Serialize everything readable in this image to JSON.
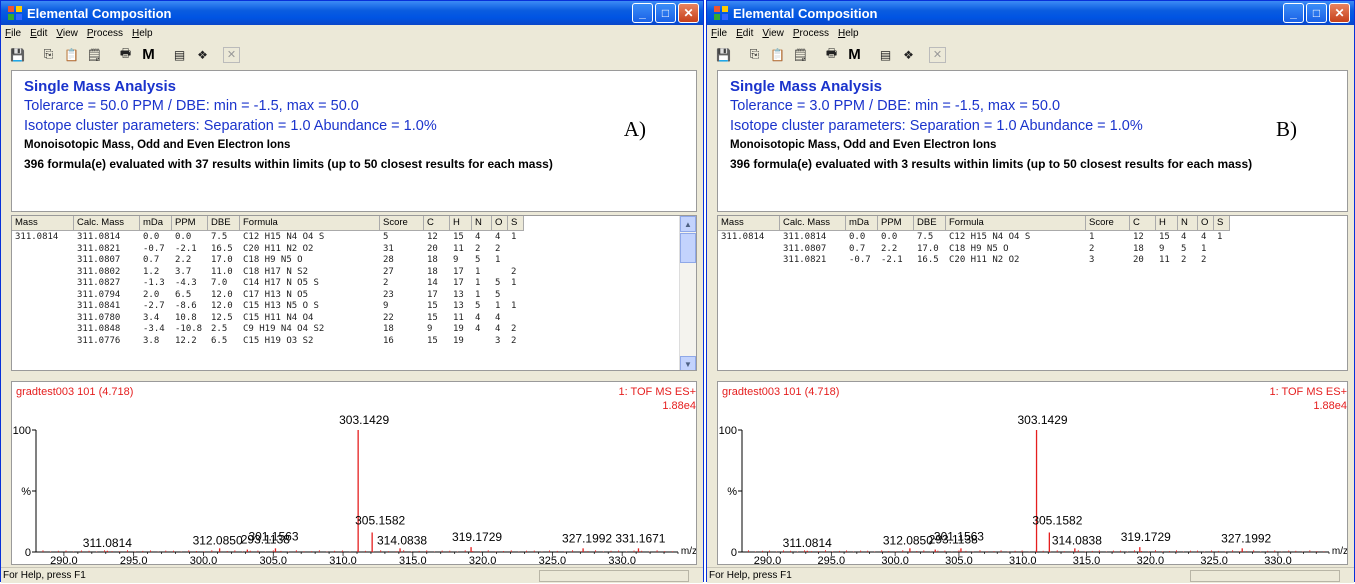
{
  "colors": {
    "title_blue": "#0054e3",
    "info_blue": "#1a33cc",
    "spectrum_red": "#e51e1e"
  },
  "windowA": {
    "title": "Elemental Composition",
    "panel_label": "A)",
    "menu": [
      "File",
      "Edit",
      "View",
      "Process",
      "Help"
    ],
    "info": {
      "heading": "Single Mass Analysis",
      "tolerance": "Tolerarce = 50.0 PPM   /  DBE: min = -1.5, max = 50.0",
      "isotope": "Isotope cluster parameters: Separation = 1.0   Abundance = 1.0%",
      "ion_mode": "Monoisotopic Mass, Odd and Even Electron Ions",
      "summary": "396 formula(e) evaluated with 37 results within limits (up to 50 closest results for each mass)"
    },
    "columns": [
      "Mass",
      "Calc. Mass",
      "mDa",
      "PPM",
      "DBE",
      "Formula",
      "Score",
      "C",
      "H",
      "N",
      "O",
      "S"
    ],
    "rows": [
      [
        "311.0814",
        "311.0814",
        "0.0",
        "0.0",
        "7.5",
        "C12 H15 N4 O4 S",
        "5",
        "12",
        "15",
        "4",
        "4",
        "1"
      ],
      [
        "",
        "311.0821",
        "-0.7",
        "-2.1",
        "16.5",
        "C20 H11 N2 O2",
        "31",
        "20",
        "11",
        "2",
        "2",
        ""
      ],
      [
        "",
        "311.0807",
        "0.7",
        "2.2",
        "17.0",
        "C18 H9 N5 O",
        "28",
        "18",
        "9",
        "5",
        "1",
        ""
      ],
      [
        "",
        "311.0802",
        "1.2",
        "3.7",
        "11.0",
        "C18 H17 N S2",
        "27",
        "18",
        "17",
        "1",
        "",
        "2"
      ],
      [
        "",
        "311.0827",
        "-1.3",
        "-4.3",
        "7.0",
        "C14 H17 N O5 S",
        "2",
        "14",
        "17",
        "1",
        "5",
        "1"
      ],
      [
        "",
        "311.0794",
        "2.0",
        "6.5",
        "12.0",
        "C17 H13 N O5",
        "23",
        "17",
        "13",
        "1",
        "5",
        ""
      ],
      [
        "",
        "311.0841",
        "-2.7",
        "-8.6",
        "12.0",
        "C15 H13 N5 O S",
        "9",
        "15",
        "13",
        "5",
        "1",
        "1"
      ],
      [
        "",
        "311.0780",
        "3.4",
        "10.8",
        "12.5",
        "C15 H11 N4 O4",
        "22",
        "15",
        "11",
        "4",
        "4",
        ""
      ],
      [
        "",
        "311.0848",
        "-3.4",
        "-10.8",
        "2.5",
        "C9 H19 N4 O4 S2",
        "18",
        "9",
        "19",
        "4",
        "4",
        "2"
      ],
      [
        "",
        "311.0776",
        "3.8",
        "12.2",
        "6.5",
        "C15 H19 O3 S2",
        "16",
        "15",
        "19",
        "",
        "3",
        "2"
      ]
    ],
    "spectrum": {
      "sample": "gradtest003 101 (4.718)",
      "mode": "1: TOF MS ES+",
      "intensity": "1.88e4",
      "y_ticks": [
        "100",
        "%",
        "0"
      ],
      "x_unit": "m/z",
      "x_ticks": [
        "290.0",
        "295.0",
        "300.0",
        "305.0",
        "310.0",
        "315.0",
        "320.0",
        "325.0",
        "330.0"
      ],
      "peak_labels": [
        "311.0814",
        "312.0850",
        "293.1138",
        "301.1563",
        "303.1429",
        "305.1582",
        "314.0838",
        "319.1729",
        "327.1992",
        "331.1671"
      ]
    },
    "status": "For Help, press F1"
  },
  "windowB": {
    "title": "Elemental Composition",
    "panel_label": "B)",
    "menu": [
      "File",
      "Edit",
      "View",
      "Process",
      "Help"
    ],
    "info": {
      "heading": "Single Mass Analysis",
      "tolerance": "Tolerance = 3.0 PPM   /  DBE: min = -1.5, max = 50.0",
      "isotope": "Isotope cluster parameters: Separation = 1.0   Abundance = 1.0%",
      "ion_mode": "Monoisotopic Mass, Odd and Even Electron Ions",
      "summary": "396 formula(e) evaluated with 3 results within limits (up to 50 closest results for each mass)"
    },
    "columns": [
      "Mass",
      "Calc. Mass",
      "mDa",
      "PPM",
      "DBE",
      "Formula",
      "Score",
      "C",
      "H",
      "N",
      "O",
      "S"
    ],
    "rows": [
      [
        "311.0814",
        "311.0814",
        "0.0",
        "0.0",
        "7.5",
        "C12 H15 N4 O4 S",
        "1",
        "12",
        "15",
        "4",
        "4",
        "1"
      ],
      [
        "",
        "311.0807",
        "0.7",
        "2.2",
        "17.0",
        "C18 H9 N5 O",
        "2",
        "18",
        "9",
        "5",
        "1",
        ""
      ],
      [
        "",
        "311.0821",
        "-0.7",
        "-2.1",
        "16.5",
        "C20 H11 N2 O2",
        "3",
        "20",
        "11",
        "2",
        "2",
        ""
      ]
    ],
    "spectrum": {
      "sample": "gradtest003 101 (4.718)",
      "mode": "1: TOF MS ES+",
      "intensity": "1.88e4",
      "y_ticks": [
        "100",
        "%",
        "0"
      ],
      "x_unit": "m/z",
      "x_ticks": [
        "290.0",
        "295.0",
        "300.0",
        "305.0",
        "310.0",
        "315.0",
        "320.0",
        "325.0",
        "330.0"
      ],
      "peak_labels": [
        "311.0814",
        "312.0850",
        "293.1138",
        "301.1563",
        "303.1429",
        "305.1582",
        "314.0838",
        "319.1729",
        "327.1992"
      ]
    },
    "status": "For Help, press F1"
  },
  "chart_data": [
    {
      "type": "bar",
      "title": "gradtest003 101 (4.718)",
      "xlabel": "m/z",
      "ylabel": "%",
      "xlim": [
        288,
        334
      ],
      "ylim": [
        0,
        100
      ],
      "x": [
        293.1138,
        301.1563,
        303.1429,
        305.1582,
        311.0814,
        312.085,
        314.0838,
        319.1729,
        327.1992,
        331.1671
      ],
      "values": [
        1,
        3,
        2,
        3,
        100,
        16,
        3,
        4,
        3,
        3
      ]
    },
    {
      "type": "bar",
      "title": "gradtest003 101 (4.718)",
      "xlabel": "m/z",
      "ylabel": "%",
      "xlim": [
        288,
        334
      ],
      "ylim": [
        0,
        100
      ],
      "x": [
        293.1138,
        301.1563,
        303.1429,
        305.1582,
        311.0814,
        312.085,
        314.0838,
        319.1729,
        327.1992
      ],
      "values": [
        1,
        3,
        2,
        3,
        100,
        16,
        3,
        4,
        3
      ]
    }
  ]
}
